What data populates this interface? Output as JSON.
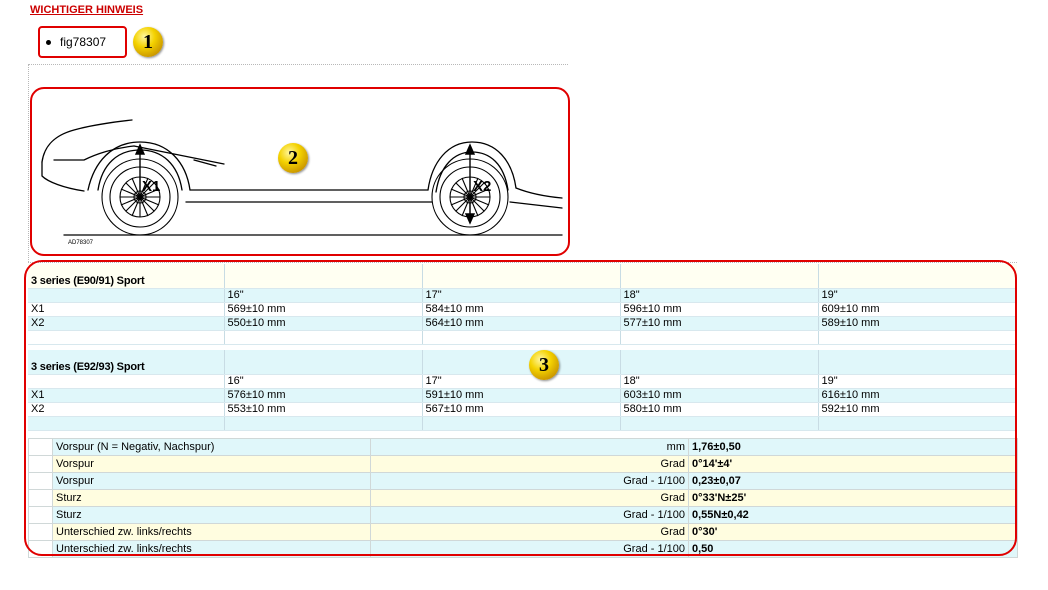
{
  "heading": "WICHTIGER HINWEIS",
  "figure_link": "fig78307",
  "markers": [
    "1",
    "2",
    "3"
  ],
  "diagram": {
    "label_front": "X1",
    "label_rear": "X2",
    "figure_code": "AD78307"
  },
  "tables": [
    {
      "title": "3 series (E90/91) Sport",
      "sizes": [
        "16\"",
        "17\"",
        "18\"",
        "19\""
      ],
      "rows": [
        {
          "label": "X1",
          "values": [
            "569±10 mm",
            "584±10 mm",
            "596±10 mm",
            "609±10 mm"
          ]
        },
        {
          "label": "X2",
          "values": [
            "550±10 mm",
            "564±10 mm",
            "577±10 mm",
            "589±10 mm"
          ]
        }
      ]
    },
    {
      "title": "3 series (E92/93) Sport",
      "sizes": [
        "16\"",
        "17\"",
        "18\"",
        "19\""
      ],
      "rows": [
        {
          "label": "X1",
          "values": [
            "576±10 mm",
            "591±10 mm",
            "603±10 mm",
            "616±10 mm"
          ]
        },
        {
          "label": "X2",
          "values": [
            "553±10 mm",
            "567±10 mm",
            "580±10 mm",
            "592±10 mm"
          ]
        }
      ]
    }
  ],
  "specs": [
    {
      "name": "Vorspur (N = Negativ, Nachspur)",
      "unit": "mm",
      "value": "1,76±0,50"
    },
    {
      "name": "Vorspur",
      "unit": "Grad",
      "value": "0°14'±4'"
    },
    {
      "name": "Vorspur",
      "unit": "Grad - 1/100",
      "value": "0,23±0,07"
    },
    {
      "name": "Sturz",
      "unit": "Grad",
      "value": "0°33'N±25'"
    },
    {
      "name": "Sturz",
      "unit": "Grad - 1/100",
      "value": "0,55N±0,42"
    },
    {
      "name": "Unterschied zw. links/rechts",
      "unit": "Grad",
      "value": "0°30'"
    },
    {
      "name": "Unterschied zw. links/rechts",
      "unit": "Grad - 1/100",
      "value": "0,50"
    }
  ],
  "colors": {
    "heading": "#cc0000",
    "highlight_border": "#e00000",
    "row_cyan": "#e0f7fa",
    "row_yellow": "#fffde0",
    "marker_gold": "#f4d200"
  }
}
